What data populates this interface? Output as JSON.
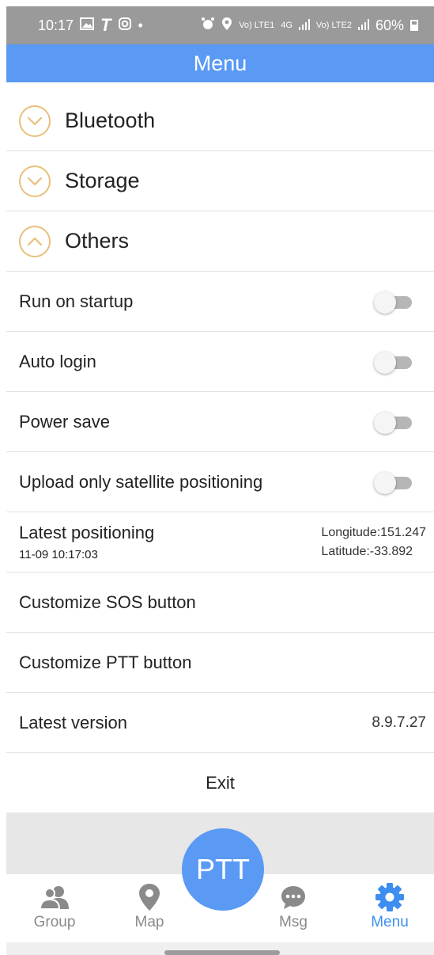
{
  "status_bar": {
    "time": "10:17",
    "left_icons": [
      "image-icon",
      "t-icon",
      "instagram-icon",
      "dot-icon"
    ],
    "dot": "•",
    "right_icons": [
      "alarm-icon",
      "location-icon"
    ],
    "signal_text_1": "Vo) LTE1",
    "net": "4G",
    "signal_text_2": "Vo) LTE2",
    "battery": "60%"
  },
  "header": {
    "title": "Menu"
  },
  "sections": [
    {
      "label": "Bluetooth",
      "state": "collapsed",
      "icon": "chevron-down-icon"
    },
    {
      "label": "Storage",
      "state": "collapsed",
      "icon": "chevron-down-icon"
    },
    {
      "label": "Others",
      "state": "expanded",
      "icon": "chevron-up-icon"
    }
  ],
  "settings": [
    {
      "label": "Run on startup",
      "enabled": false
    },
    {
      "label": "Auto login",
      "enabled": false
    },
    {
      "label": "Power save",
      "enabled": false
    },
    {
      "label": "Upload only satellite positioning",
      "enabled": false
    }
  ],
  "positioning": {
    "label": "Latest positioning",
    "timestamp": "11-09 10:17:03",
    "longitude": "Longitude:151.247",
    "latitude": "Latitude:-33.892"
  },
  "actions": {
    "sos": "Customize SOS button",
    "ptt": "Customize PTT button"
  },
  "version": {
    "label": "Latest version",
    "value": "8.9.7.27"
  },
  "exit_label": "Exit",
  "ptt_button": "PTT",
  "bottom_nav": [
    {
      "label": "Group",
      "icon": "people-icon",
      "active": false
    },
    {
      "label": "Map",
      "icon": "map-pin-icon",
      "active": false
    },
    {
      "label": "Msg",
      "icon": "chat-icon",
      "active": false
    },
    {
      "label": "Menu",
      "icon": "gear-icon",
      "active": true
    }
  ],
  "colors": {
    "accent": "#5a9af4",
    "active_nav": "#3d8ef0",
    "chevron": "#e8c07a",
    "status_bar": "#9a9a9a"
  }
}
